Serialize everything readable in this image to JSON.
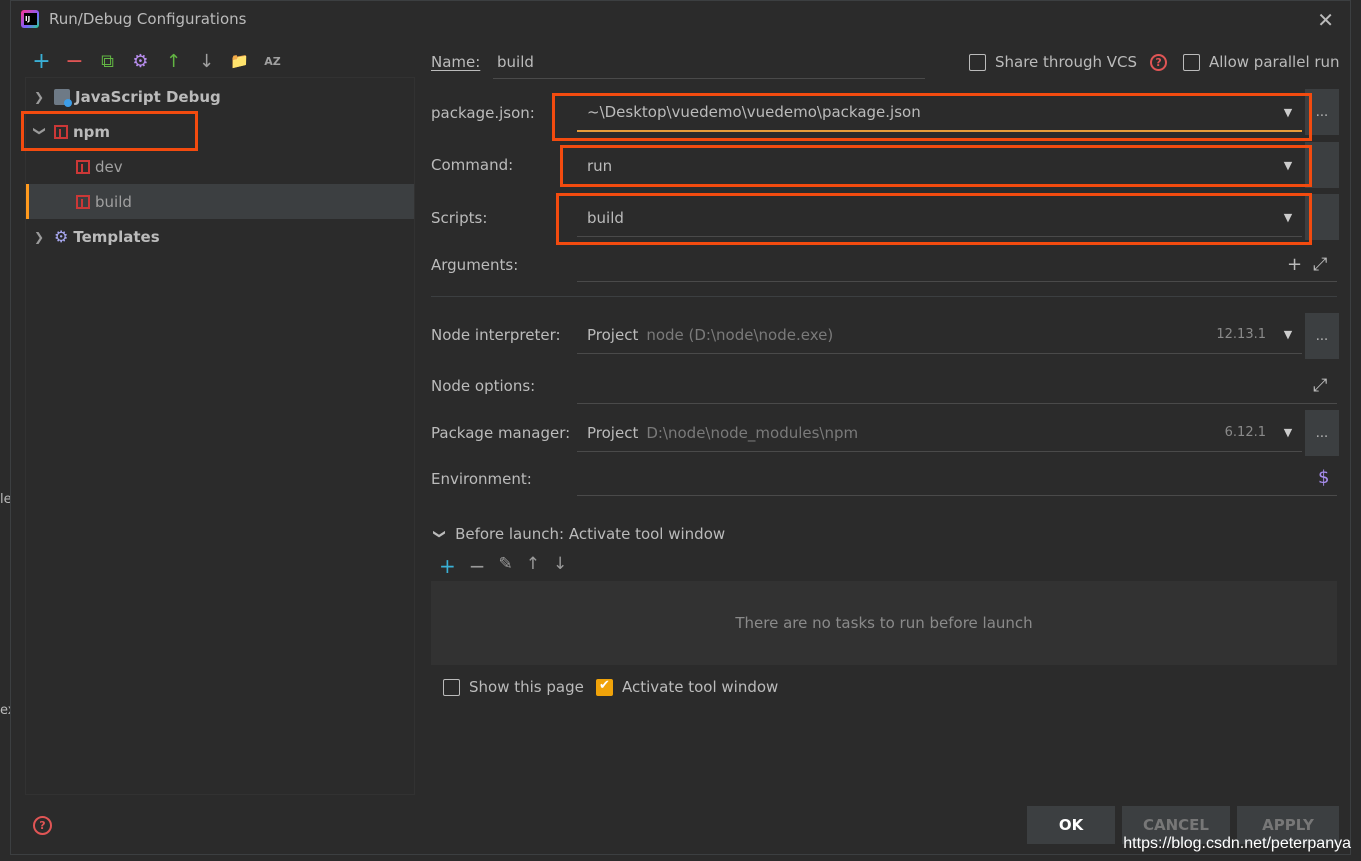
{
  "window": {
    "title": "Run/Debug Configurations",
    "close_glyph": "✕"
  },
  "toolbar": {
    "add": "+",
    "remove": "−",
    "copy": "⧉",
    "settings": "⚙",
    "move_up": "↑",
    "move_down": "↓",
    "folder": "📁",
    "sort": "AZ"
  },
  "tree": {
    "items": [
      {
        "label": "JavaScript Debug"
      },
      {
        "label": "npm"
      },
      {
        "label": "dev"
      },
      {
        "label": "build"
      },
      {
        "label": "Templates"
      }
    ]
  },
  "form": {
    "name_label": "Name:",
    "name_value": "build",
    "share_vcs": "Share through VCS",
    "allow_parallel": "Allow parallel run",
    "package_json_label": "package.json:",
    "package_json_value": "~\\Desktop\\vuedemo\\vuedemo\\package.json",
    "command_label": "Command:",
    "command_value": "run",
    "scripts_label": "Scripts:",
    "scripts_value": "build",
    "arguments_label": "Arguments:",
    "node_interpreter_label": "Node interpreter:",
    "node_interpreter_value": "Project",
    "node_interpreter_path": "node (D:\\node\\node.exe)",
    "node_version": "12.13.1",
    "node_options_label": "Node options:",
    "package_manager_label": "Package manager:",
    "package_manager_value": "Project",
    "package_manager_path": "D:\\node\\node_modules\\npm",
    "package_manager_version": "6.12.1",
    "environment_label": "Environment:",
    "dots": "...",
    "dropdown_arrow": "▼",
    "plus": "+",
    "expand": "⤢",
    "dollar": "$"
  },
  "before_launch": {
    "title": "Before launch: Activate tool window",
    "empty_text": "There are no tasks to run before launch",
    "show_this_page": "Show this page",
    "activate_tool_window": "Activate tool window"
  },
  "buttons": {
    "ok": "OK",
    "cancel": "CANCEL",
    "apply": "APPLY"
  },
  "watermark": "https://blog.csdn.net/peterpanya",
  "edge": {
    "a": "le",
    "b": "ex"
  },
  "colors": {
    "highlight": "#f34b0f",
    "selected_accent": "#ff9a1e",
    "npm_red": "#cb3837"
  }
}
